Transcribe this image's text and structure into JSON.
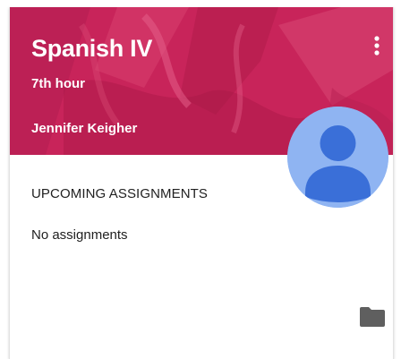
{
  "card": {
    "title": "Spanish IV",
    "section": "7th hour",
    "teacher": "Jennifer Keigher",
    "upcoming_heading": "UPCOMING ASSIGNMENTS",
    "upcoming_empty": "No assignments"
  },
  "icons": {
    "more": "more-vert-icon",
    "avatar": "person-avatar-icon",
    "folder": "folder-icon"
  },
  "colors": {
    "header_bg": "#c8245a",
    "avatar_bg": "#8fb4f2",
    "avatar_figure": "#3a6fd8",
    "folder": "#5f5f5f"
  }
}
